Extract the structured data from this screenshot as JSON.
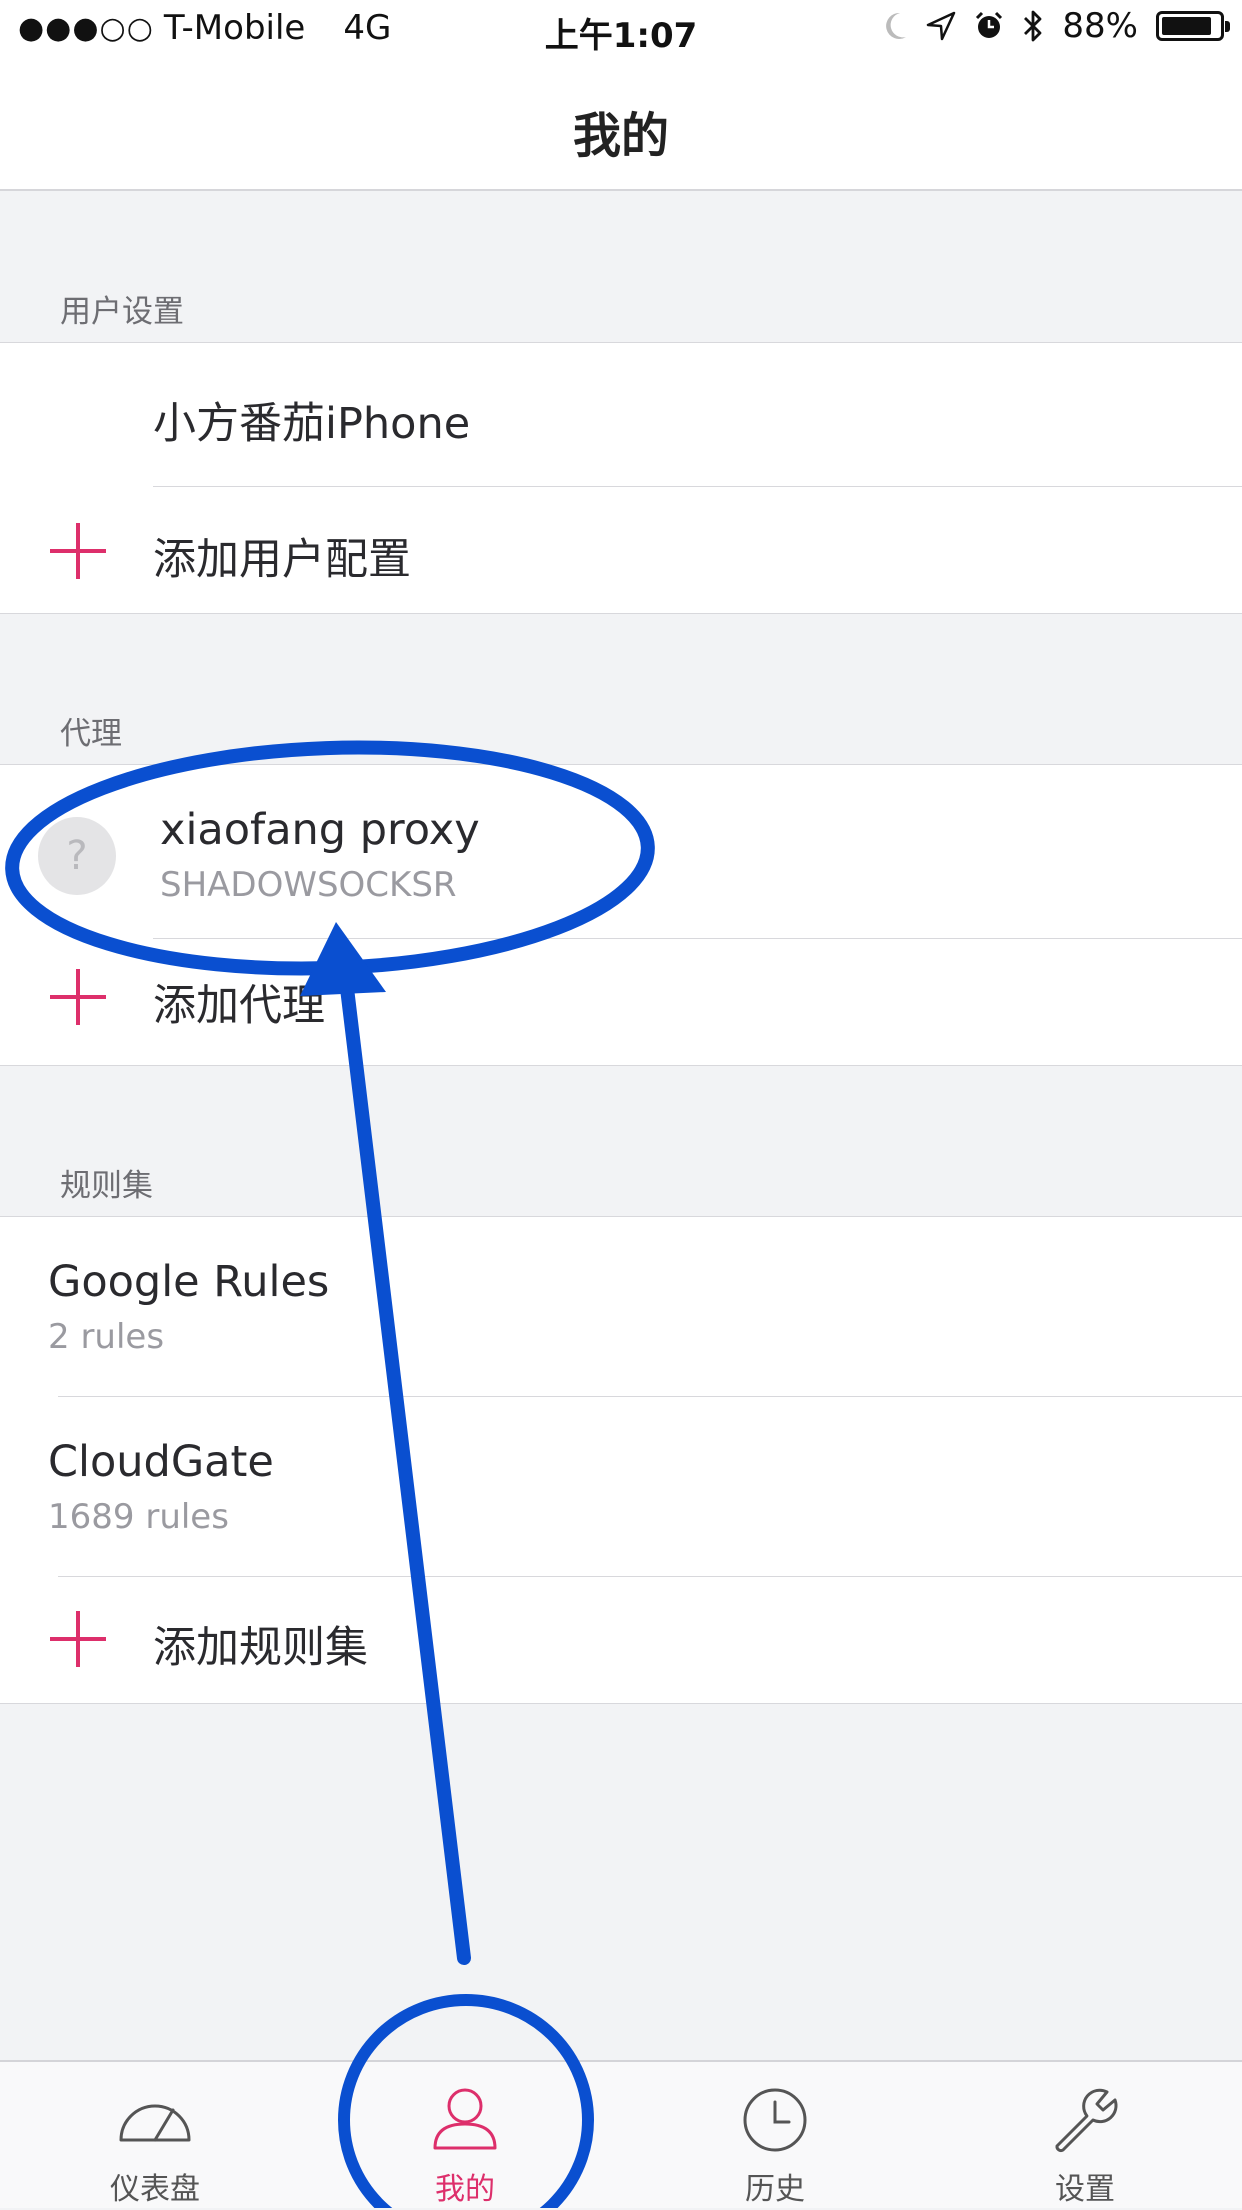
{
  "status_bar": {
    "signal": "●●●○○",
    "carrier": "T-Mobile",
    "network": "4G",
    "time": "上午1:07",
    "battery_percent_label": "88%",
    "battery_level": 0.88,
    "icons": [
      "moon-icon",
      "location-icon",
      "alarm-icon",
      "bluetooth-icon",
      "battery-icon"
    ]
  },
  "nav": {
    "title": "我的"
  },
  "sections": {
    "user": {
      "header": "用户设置",
      "items": [
        {
          "title": "小方番茄iPhone"
        }
      ],
      "add_label": "添加用户配置"
    },
    "proxy": {
      "header": "代理",
      "items": [
        {
          "title": "xiaofang proxy",
          "subtitle": "SHADOWSOCKSR",
          "icon": "?"
        }
      ],
      "add_label": "添加代理"
    },
    "rules": {
      "header": "规则集",
      "items": [
        {
          "title": "Google Rules",
          "subtitle": "2 rules"
        },
        {
          "title": "CloudGate",
          "subtitle": "1689 rules"
        }
      ],
      "add_label": "添加规则集"
    }
  },
  "tabbar": {
    "tabs": [
      {
        "label": "仪表盘",
        "icon": "gauge-icon",
        "active": false
      },
      {
        "label": "我的",
        "icon": "person-icon",
        "active": true
      },
      {
        "label": "历史",
        "icon": "clock-icon",
        "active": false
      },
      {
        "label": "设置",
        "icon": "wrench-icon",
        "active": false
      }
    ]
  },
  "colors": {
    "accent": "#dd2f6b",
    "annotation": "#0a4fd0",
    "background": "#f2f3f5"
  }
}
